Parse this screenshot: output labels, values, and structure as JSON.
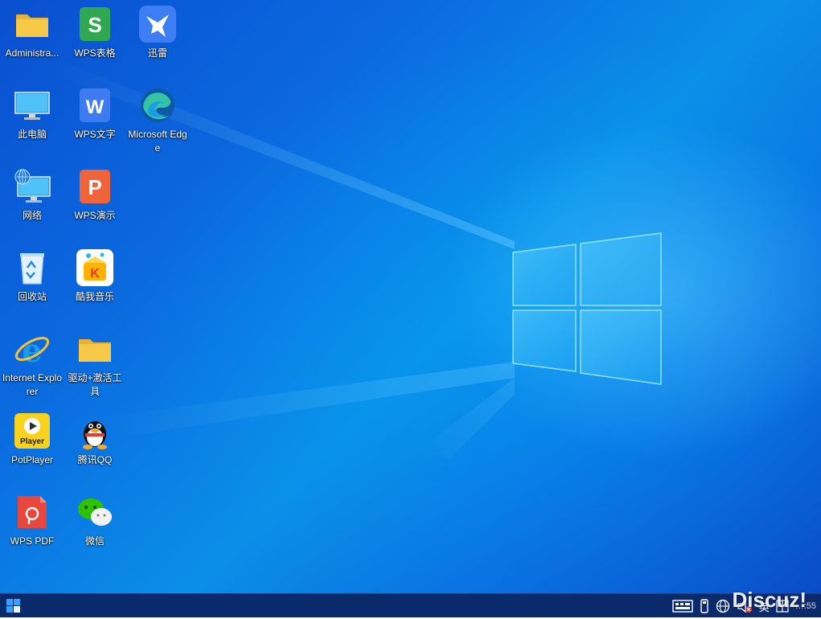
{
  "desktop": {
    "icons": [
      {
        "label": "Administra...",
        "icon": "folder-icon"
      },
      {
        "label": "WPS表格",
        "icon": "wps-spreadsheet-icon"
      },
      {
        "label": "迅雷",
        "icon": "xunlei-icon"
      },
      {
        "label": "此电脑",
        "icon": "this-pc-icon"
      },
      {
        "label": "WPS文字",
        "icon": "wps-writer-icon"
      },
      {
        "label": "Microsoft Edge",
        "icon": "edge-icon"
      },
      {
        "label": "网络",
        "icon": "network-icon"
      },
      {
        "label": "WPS演示",
        "icon": "wps-presentation-icon"
      },
      {
        "label": "回收站",
        "icon": "recycle-bin-icon"
      },
      {
        "label": "酷我音乐",
        "icon": "kuwo-music-icon"
      },
      {
        "label": "Internet Explorer",
        "icon": "internet-explorer-icon"
      },
      {
        "label": "驱动+激活工具",
        "icon": "folder-icon"
      },
      {
        "label": "PotPlayer",
        "icon": "potplayer-icon"
      },
      {
        "label": "腾讯QQ",
        "icon": "qq-icon"
      },
      {
        "label": "WPS PDF",
        "icon": "wps-pdf-icon"
      },
      {
        "label": "微信",
        "icon": "wechat-icon"
      }
    ],
    "potplayer_icon_text": "Player"
  },
  "taskbar": {
    "start_icon": "windows-start-icon",
    "tray": {
      "input_language": "英",
      "clock": "…:55"
    },
    "watermark": "Discuz!"
  },
  "colors": {
    "taskbar": "#0b2a6b",
    "wallpaper": "#0a6fe0",
    "folder": "#f7c948",
    "wps_sheet": "#2fa84f",
    "wps_writer": "#3e7bf0",
    "wps_presentation": "#f0643c",
    "wps_pdf": "#e8473d"
  }
}
